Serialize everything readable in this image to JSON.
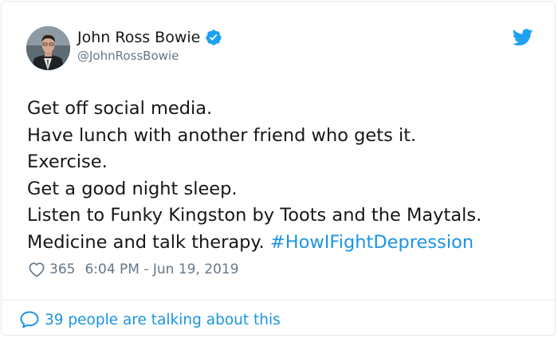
{
  "tweet": {
    "author": {
      "display_name": "John Ross Bowie",
      "handle": "@JohnRossBowie",
      "verified": true
    },
    "lines": [
      "Get off social media.",
      "Have lunch with another friend who gets it.",
      "Exercise.",
      "Get a good night sleep.",
      "Listen to Funky Kingston by Toots and the Maytals."
    ],
    "last_line_text": "Medicine and talk therapy. ",
    "hashtag": "#HowIFightDepression",
    "likes": "365",
    "timestamp": "6:04 PM - Jun 19, 2019",
    "talking": "39 people are talking about this"
  },
  "icons": {
    "verified": "verified-badge-icon",
    "bird": "twitter-bird-icon",
    "heart": "heart-icon",
    "bubble": "speech-bubble-icon"
  },
  "colors": {
    "text_primary": "#14171a",
    "text_secondary": "#657786",
    "accent": "#1b95e0",
    "border": "#e1e8ed"
  }
}
